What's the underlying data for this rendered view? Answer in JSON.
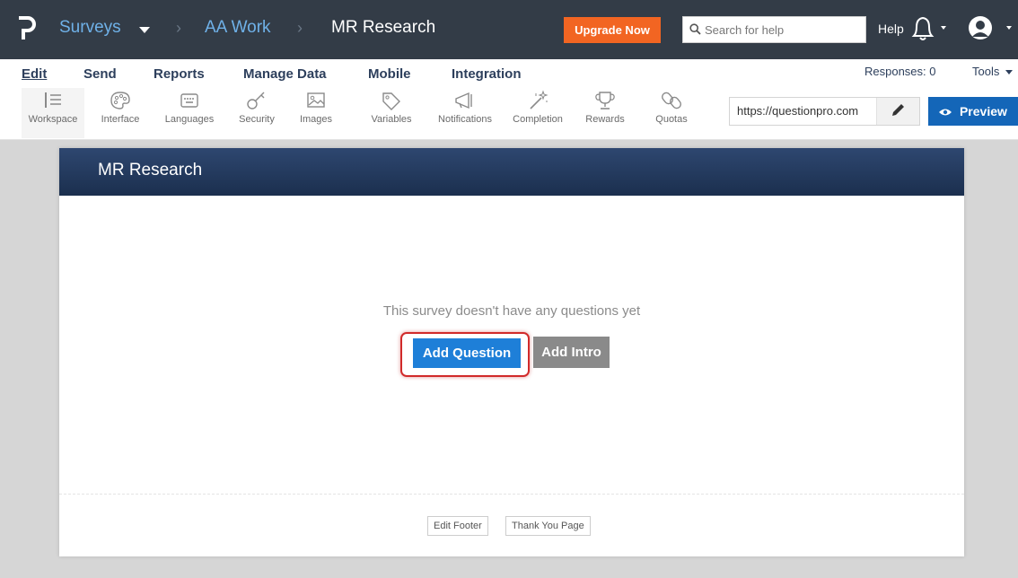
{
  "topbar": {
    "breadcrumbs": [
      "Surveys",
      "AA Work",
      "MR Research"
    ],
    "upgrade_label": "Upgrade Now",
    "search_placeholder": "Search for help",
    "help_label": "Help"
  },
  "menu": {
    "items": [
      "Edit",
      "Send",
      "Reports",
      "Manage Data",
      "Mobile",
      "Integration"
    ],
    "active": "Edit",
    "responses": "Responses: 0",
    "tools_label": "Tools"
  },
  "toolbar": {
    "tools": [
      "Workspace",
      "Interface",
      "Languages",
      "Security",
      "Images",
      "Variables",
      "Notifications",
      "Completion",
      "Rewards",
      "Quotas"
    ],
    "url_value": "https://questionpro.com",
    "preview_label": "Preview"
  },
  "survey": {
    "title": "MR Research",
    "empty_message": "This survey doesn't have any questions yet",
    "add_question_label": "Add Question",
    "add_intro_label": "Add Intro",
    "edit_footer_label": "Edit Footer",
    "thank_you_label": "Thank You Page"
  },
  "icons": {
    "logo": "questionpro-logo-icon",
    "search": "search-icon",
    "bell": "bell-icon",
    "avatar": "user-avatar-icon",
    "pencil": "pencil-icon",
    "eye": "eye-icon"
  },
  "colors": {
    "topbar": "#333c47",
    "link": "#6fb1e8",
    "upgrade": "#f26522",
    "primary": "#1e7fd8",
    "preview": "#1466b8",
    "panel_header": "#1b2f4e",
    "highlight": "#d12a2a"
  }
}
